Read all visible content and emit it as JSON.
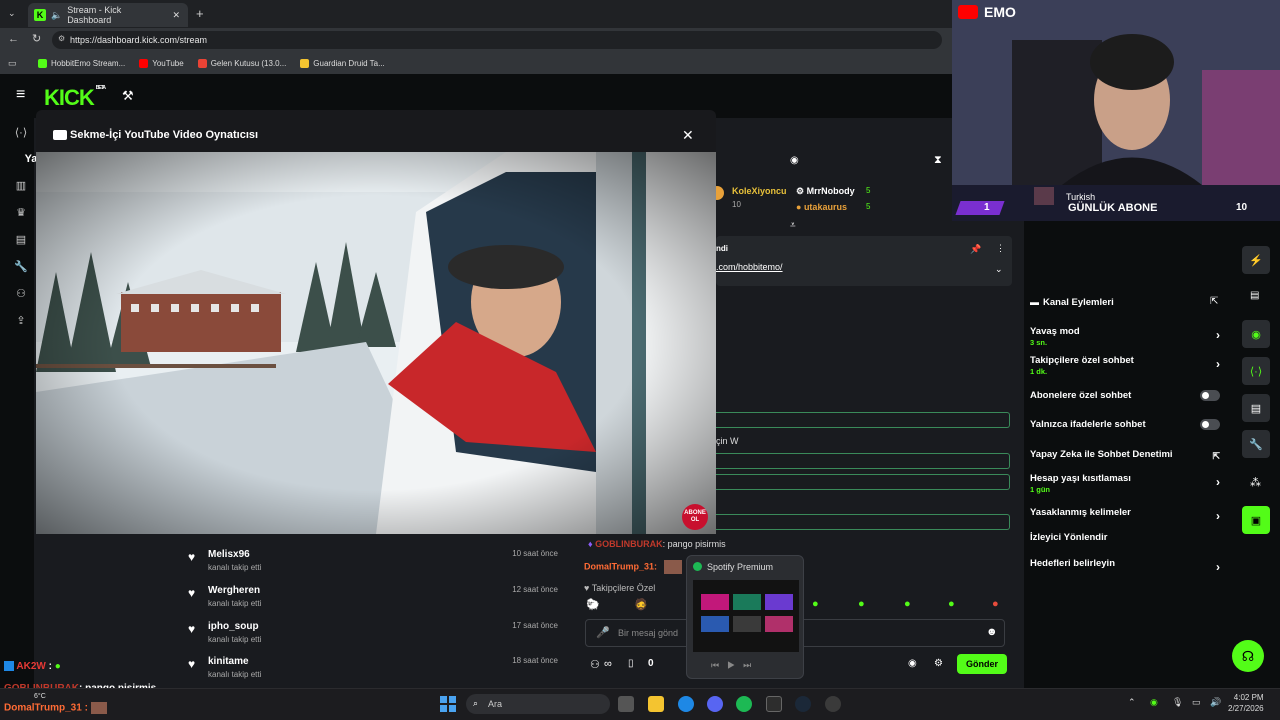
{
  "browser": {
    "tab_title": "Stream - Kick Dashboard",
    "url": "https://dashboard.kick.com/stream",
    "bookmarks": [
      {
        "label": "HobbitEmo Stream...",
        "color": "#53fc18"
      },
      {
        "label": "YouTube",
        "color": "#ff0000"
      },
      {
        "label": "Gelen Kutusu (13.0...",
        "color": "#ea4335"
      },
      {
        "label": "Guardian Druid Ta...",
        "color": "#f4c430"
      }
    ]
  },
  "kick": {
    "logo": "KICK",
    "beta": "BETA",
    "left_rail_label": "Ya"
  },
  "modal": {
    "title": "Sekme-İçi YouTube Video Oynatıcısı",
    "close": "✕",
    "abone_badge": "ABONE OL"
  },
  "followers": [
    {
      "name": "Melisx96",
      "action": "kanalı takip etti",
      "time": "10 saat önce"
    },
    {
      "name": "Wergheren",
      "action": "kanalı takip etti",
      "time": "12 saat önce"
    },
    {
      "name": "ipho_soup",
      "action": "kanalı takip etti",
      "time": "17 saat önce"
    },
    {
      "name": "kinitame",
      "action": "kanalı takip etti",
      "time": "18 saat önce"
    }
  ],
  "chat": {
    "top_users": [
      {
        "name": "KoleXiyoncu",
        "count": "10"
      },
      {
        "name": "MrrNobody",
        "count": "5"
      },
      {
        "name": "utakaurus",
        "count": "5"
      }
    ],
    "pinned_label": "ndi",
    "pinned_link": ".com/hobbitemo/",
    "partial_line": "çin W",
    "lines": [
      {
        "user": "GOBLINBURAK",
        "text": ": pango pisirmis",
        "color": "#c0392b"
      },
      {
        "user": "DomalTrump_31:",
        "text": "",
        "color": "#ff6b35"
      }
    ],
    "followers_only": "Takipçilere Özel",
    "input_placeholder": "Bir mesaj gönd",
    "viewer_count": "0",
    "send": "Gönder"
  },
  "channel_actions": {
    "title": "Kanal Eylemleri",
    "items": [
      {
        "label": "Yavaş mod",
        "hint": "3 sn.",
        "kind": "chevron"
      },
      {
        "label": "Takipçilere özel sohbet",
        "hint": "1 dk.",
        "kind": "chevron"
      },
      {
        "label": "Abonelere özel sohbet",
        "hint": "",
        "kind": "toggle"
      },
      {
        "label": "Yalnızca ifadelerle sohbet",
        "hint": "",
        "kind": "toggle"
      },
      {
        "label": "Yapay Zeka ile Sohbet Denetimi",
        "hint": "",
        "kind": "external"
      },
      {
        "label": "Hesap yaşı kısıtlaması",
        "hint": "1 gün",
        "kind": "chevron"
      },
      {
        "label": "Yasaklanmış kelimeler",
        "hint": "",
        "kind": "chevron"
      },
      {
        "label": "İzleyici Yönlendir",
        "hint": "",
        "kind": "none"
      },
      {
        "label": "Hedefleri belirleyin",
        "hint": "",
        "kind": "chevron"
      }
    ]
  },
  "overlay": {
    "webcam_name": "EMO",
    "sub_language": "Turkish",
    "sub_title": "GÜNLÜK ABONE",
    "sub_left": "1",
    "sub_right": "10",
    "chat_user1": "AK2W",
    "chat_user2": "GOBLINBURAK",
    "chat_text2": ": pango pisirmis",
    "chat_user3": "DomalTrump_31 :",
    "weather": "6°C"
  },
  "spotify": {
    "title": "Spotify Premium"
  },
  "taskbar": {
    "search": "Ara",
    "time": "4:02 PM",
    "date": "2/27/2026"
  }
}
